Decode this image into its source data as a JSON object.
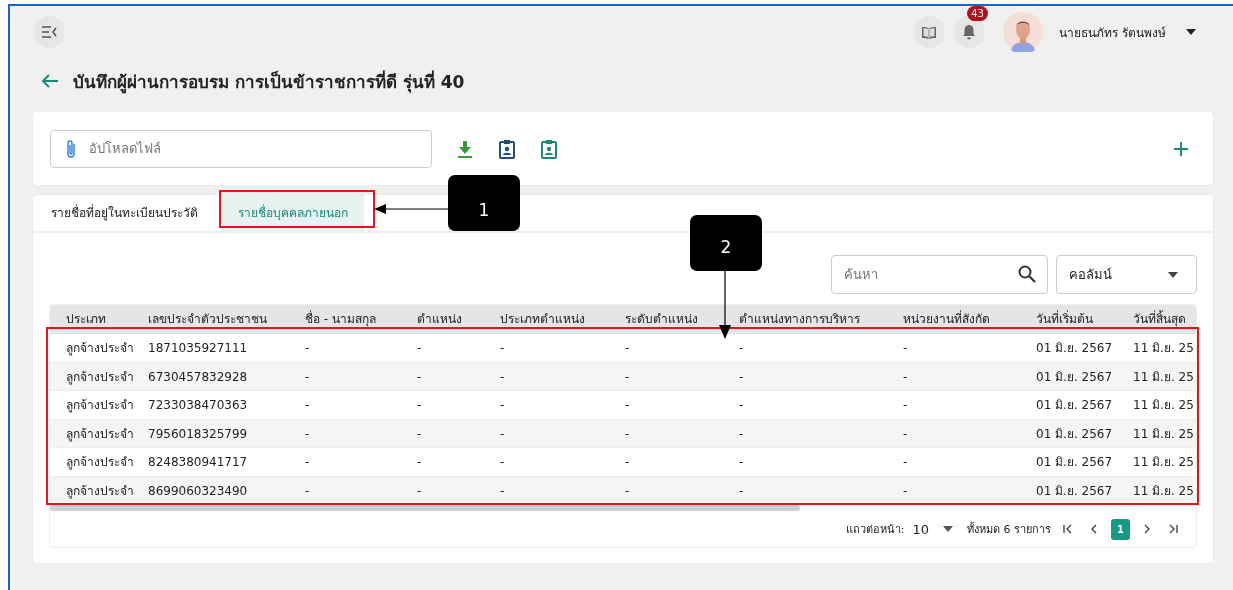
{
  "header": {
    "notification_count": "43",
    "user_name": "นายธนภัทร รัตนพงษ์"
  },
  "page_title": "บันทึกผู้ผ่านการอบรม การเป็นข้าราชการที่ดี รุ่นที่ 40",
  "upload": {
    "placeholder": "อัปโหลดไฟล์"
  },
  "tabs": [
    {
      "label": "รายชื่อที่อยู่ในทะเบียนประวัติ",
      "selected": false
    },
    {
      "label": "รายชื่อบุคคลภายนอก",
      "selected": true
    }
  ],
  "search": {
    "placeholder": "ค้นหา"
  },
  "column_picker": {
    "value": "คอลัมน์"
  },
  "table": {
    "columns": [
      "ประเภท",
      "เลขประจำตัวประชาชน",
      "ชื่อ - นามสกุล",
      "ตำแหน่ง",
      "ประเภทตำแหน่ง",
      "ระดับตำแหน่ง",
      "ตำแหน่งทางการบริหาร",
      "หน่วยงานที่สังกัด",
      "วันที่เริ่มต้น",
      "วันที่สิ้นสุด"
    ],
    "rows": [
      [
        "ลูกจ้างประจำ",
        "1871035927111",
        "-",
        "-",
        "-",
        "-",
        "-",
        "-",
        "01 มิ.ย. 2567",
        "11 มิ.ย. 25"
      ],
      [
        "ลูกจ้างประจำ",
        "6730457832928",
        "-",
        "-",
        "-",
        "-",
        "-",
        "-",
        "01 มิ.ย. 2567",
        "11 มิ.ย. 25"
      ],
      [
        "ลูกจ้างประจำ",
        "7233038470363",
        "-",
        "-",
        "-",
        "-",
        "-",
        "-",
        "01 มิ.ย. 2567",
        "11 มิ.ย. 25"
      ],
      [
        "ลูกจ้างประจำ",
        "7956018325799",
        "-",
        "-",
        "-",
        "-",
        "-",
        "-",
        "01 มิ.ย. 2567",
        "11 มิ.ย. 25"
      ],
      [
        "ลูกจ้างประจำ",
        "8248380941717",
        "-",
        "-",
        "-",
        "-",
        "-",
        "-",
        "01 มิ.ย. 2567",
        "11 มิ.ย. 25"
      ],
      [
        "ลูกจ้างประจำ",
        "8699060323490",
        "-",
        "-",
        "-",
        "-",
        "-",
        "-",
        "01 มิ.ย. 2567",
        "11 มิ.ย. 25"
      ]
    ]
  },
  "pagination": {
    "rows_per_page_label": "แถวต่อหน้า:",
    "rows_per_page": "10",
    "total": "ทั้งหมด 6 รายการ",
    "pages": [
      {
        "label": "1",
        "selected": true
      }
    ]
  },
  "annotations": [
    {
      "label": "1"
    },
    {
      "label": "2"
    }
  ]
}
